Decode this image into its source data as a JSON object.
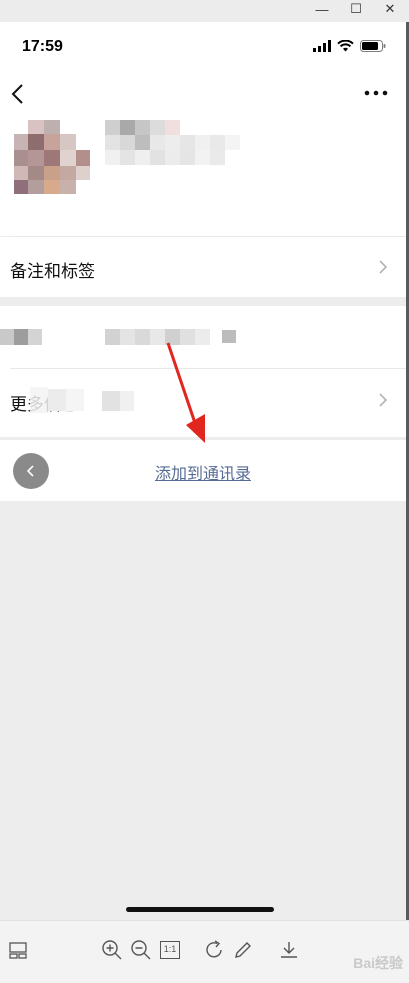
{
  "window": {
    "minimize_glyph": "—",
    "maximize_glyph": "☐",
    "close_glyph": "✕"
  },
  "status_bar": {
    "time": "17:59",
    "icons": [
      "signal-icon",
      "wifi-icon",
      "battery-icon"
    ]
  },
  "nav": {
    "back_icon": "chevron-left-icon",
    "more_icon": "ellipsis-icon"
  },
  "rows": {
    "remarks_label": "备注和标签",
    "more_info_label": "更多信息"
  },
  "actions": {
    "add_to_contacts": "添加到通讯录"
  },
  "toolbar": {
    "icons": [
      "thumbnail-icon",
      "zoom-in-icon",
      "zoom-out-icon",
      "actual-size-icon",
      "rotate-icon",
      "edit-icon",
      "download-icon"
    ],
    "actual_size_label": "1:1",
    "watermark": "Bai经验"
  },
  "colors": {
    "link": "#576b95",
    "annotation_arrow": "#e0261f",
    "background": "#ededed"
  }
}
